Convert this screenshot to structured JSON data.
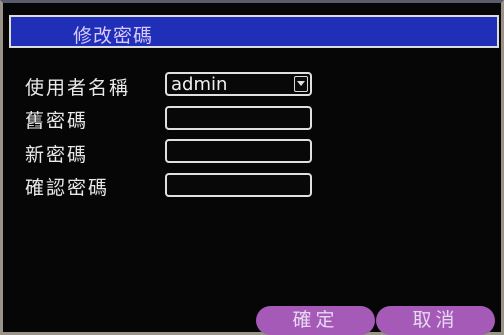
{
  "dialog": {
    "title": "修改密碼"
  },
  "form": {
    "username_label": "使用者名稱",
    "username_value": "admin",
    "old_password_label": "舊密碼",
    "new_password_label": "新密碼",
    "confirm_password_label": "確認密碼"
  },
  "buttons": {
    "ok_label": "確定",
    "cancel_label": "取消"
  },
  "colors": {
    "title_bar": "#1f2fb8",
    "button": "#a65ab8",
    "background": "#060606"
  },
  "icons": {
    "dropdown": "chevron-down-icon"
  }
}
